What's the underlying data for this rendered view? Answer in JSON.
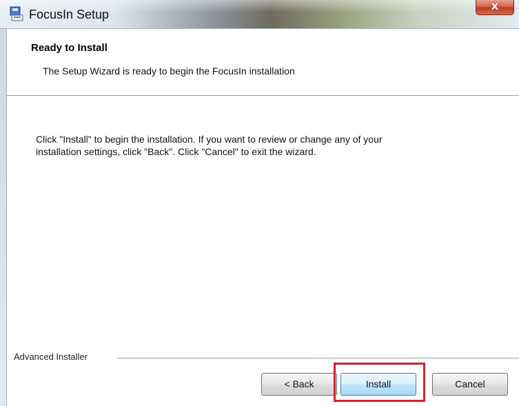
{
  "window": {
    "title": "FocusIn Setup",
    "close_label": "x",
    "app_icon": "installer-icon"
  },
  "header": {
    "title": "Ready to Install",
    "subtitle": "The Setup Wizard is ready to begin the FocusIn installation"
  },
  "body": {
    "line1": "Click \"Install\" to begin the installation.  If you want to review or change any of your",
    "line2": "installation settings, click \"Back\".  Click \"Cancel\" to exit the wizard."
  },
  "footer": {
    "brand": "Advanced Installer"
  },
  "buttons": {
    "back": "< Back",
    "install": "Install",
    "cancel": "Cancel"
  },
  "colors": {
    "highlight": "#d4202b",
    "install_border": "#3c7fb1",
    "close": "#c0391f"
  }
}
